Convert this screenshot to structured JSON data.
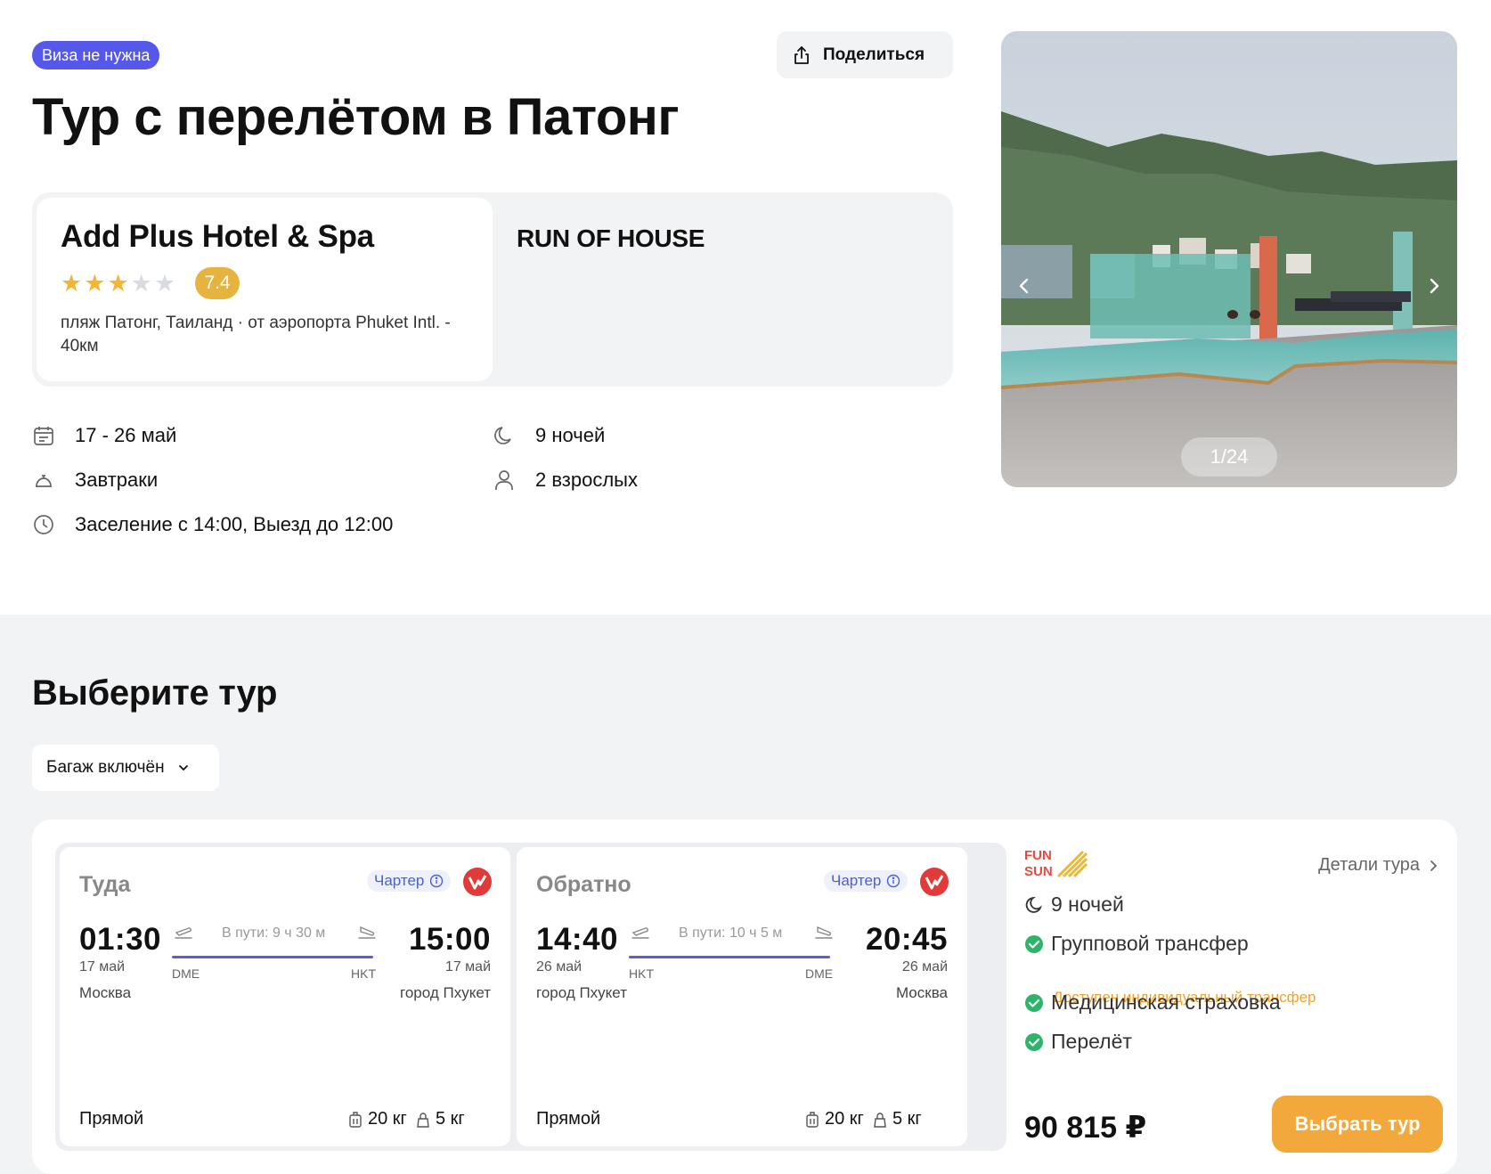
{
  "header": {
    "visa_badge": "Виза не нужна",
    "share_label": "Поделиться",
    "title": "Тур с перелётом в Патонг"
  },
  "hotel": {
    "name": "Add Plus Hotel & Spa",
    "stars": 3,
    "stars_max": 5,
    "rating": "7.4",
    "location": "пляж Патонг, Таиланд · от аэропорта Phuket Intl. - 40км",
    "room_type": "RUN OF HOUSE"
  },
  "info": {
    "dates": "17 - 26 май",
    "nights": "9 ночей",
    "meals": "Завтраки",
    "guests": "2 взрослых",
    "checkin": "Заселение с 14:00, Выезд до 12:00"
  },
  "gallery": {
    "counter": "1/24"
  },
  "choose": {
    "title": "Выберите тур",
    "filter_label": "Багаж включён"
  },
  "flights": {
    "outbound": {
      "direction": "Туда",
      "charter": "Чартер",
      "dep_time": "01:30",
      "dep_date": "17 май",
      "dep_city": "Москва",
      "dep_code": "DME",
      "duration": "В пути: 9 ч 30 м",
      "arr_time": "15:00",
      "arr_date": "17 май",
      "arr_city": "город Пхукет",
      "arr_code": "HKT",
      "type": "Прямой",
      "baggage": "20 кг",
      "hand_luggage": "5 кг"
    },
    "return": {
      "direction": "Обратно",
      "charter": "Чартер",
      "dep_time": "14:40",
      "dep_date": "26 май",
      "dep_city": "город Пхукет",
      "dep_code": "HKT",
      "duration": "В пути: 10 ч 5 м",
      "arr_time": "20:45",
      "arr_date": "26 май",
      "arr_city": "Москва",
      "arr_code": "DME",
      "type": "Прямой",
      "baggage": "20 кг",
      "hand_luggage": "5 кг"
    }
  },
  "offer": {
    "operator_logo": "FUN & SUN",
    "details_label": "Детали тура",
    "nights": "9 ночей",
    "transfer": "Групповой трансфер",
    "transfer_note": "Доступен индивидуальный трансфер",
    "insurance": "Медицинская страховка",
    "flight": "Перелёт",
    "price": "90 815 ₽",
    "select_label": "Выбрать тур"
  },
  "colors": {
    "accent": "#5558e8",
    "star": "#f2b534",
    "rating_bg": "#e7b33f",
    "cta": "#f3a83b",
    "check": "#2fb36b",
    "note": "#f0a22b"
  }
}
